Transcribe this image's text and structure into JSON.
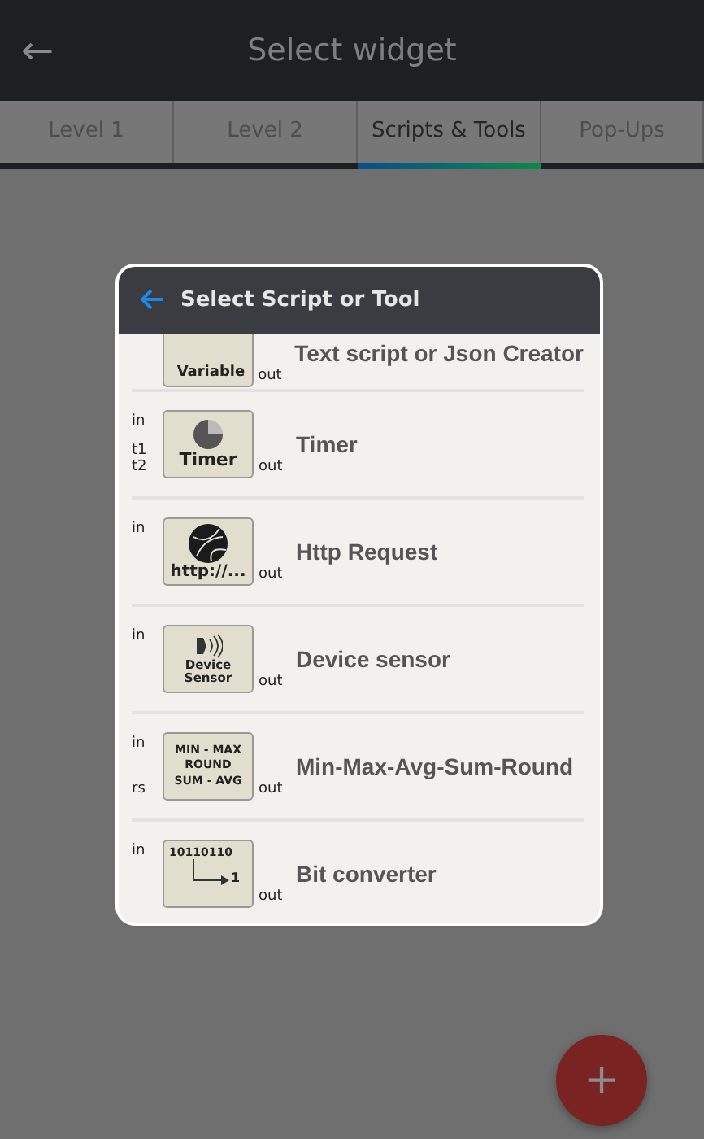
{
  "app_bar": {
    "title": "Select widget",
    "back_icon": "←"
  },
  "tabs": [
    {
      "label": "Level 1",
      "selected": false
    },
    {
      "label": "Level 2",
      "selected": false
    },
    {
      "label": "Scripts & Tools",
      "selected": true
    },
    {
      "label": "Pop-Ups",
      "selected": false
    }
  ],
  "dialog": {
    "title": "Select Script or Tool",
    "items": [
      {
        "kind": "variable",
        "title": "Text script or Json Creator",
        "lines": [
          "Variable"
        ],
        "output": "out"
      },
      {
        "kind": "timer",
        "title": "Timer",
        "inputs_top": [
          "in"
        ],
        "inputs_bottom": [
          "t1",
          "t2"
        ],
        "lines": [
          "Timer"
        ],
        "output": "out"
      },
      {
        "kind": "http",
        "title": "Http Request",
        "inputs_top": [
          "in"
        ],
        "lines": [
          "http://..."
        ],
        "output": "out"
      },
      {
        "kind": "sensor",
        "title": "Device sensor",
        "inputs_top": [
          "in"
        ],
        "lines": [
          "Device",
          "Sensor"
        ],
        "output": "out"
      },
      {
        "kind": "minmax",
        "title": "Min-Max-Avg-Sum-Round",
        "inputs_top": [
          "in"
        ],
        "inputs_bottom": [
          "rs"
        ],
        "lines": [
          "MIN - MAX",
          "ROUND",
          "SUM - AVG"
        ],
        "output": "out"
      },
      {
        "kind": "bit",
        "title": "Bit converter",
        "inputs_top": [
          "in"
        ],
        "lines": [
          "10110110",
          "1"
        ],
        "output": "out"
      }
    ]
  },
  "fab": {
    "label": "+"
  }
}
